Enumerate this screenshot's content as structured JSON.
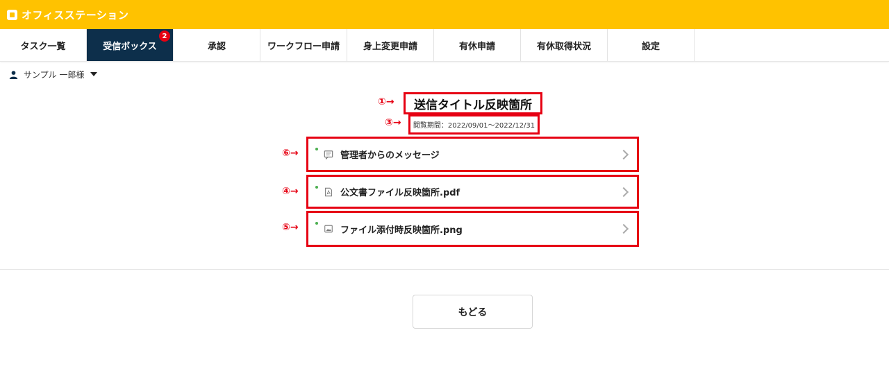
{
  "app": {
    "name": "オフィスステーション"
  },
  "nav": {
    "tabs": [
      {
        "label": "タスク一覧"
      },
      {
        "label": "受信ボックス",
        "badge": "2",
        "active": true
      },
      {
        "label": "承認"
      },
      {
        "label": "ワークフロー申請"
      },
      {
        "label": "身上変更申請"
      },
      {
        "label": "有休申請"
      },
      {
        "label": "有休取得状況"
      },
      {
        "label": "設定"
      }
    ]
  },
  "user": {
    "name": "サンプル 一郎様"
  },
  "annotations": {
    "title_marker": "①→",
    "period_marker": "③→",
    "message_marker": "⑥→",
    "pdf_marker": "④→",
    "png_marker": "⑤→"
  },
  "content": {
    "title": "送信タイトル反映箇所",
    "period": "閲覧期間：2022/09/01～2022/12/31",
    "items": [
      {
        "label": "管理者からのメッセージ",
        "icon": "message-icon"
      },
      {
        "label": "公文書ファイル反映箇所.pdf",
        "icon": "pdf-file-icon"
      },
      {
        "label": "ファイル添付時反映箇所.png",
        "icon": "image-file-icon"
      }
    ]
  },
  "back_button": {
    "label": "もどる"
  },
  "colors": {
    "header": "#ffc200",
    "active_tab": "#0d2f4b",
    "badge": "#e60012",
    "annotation": "#e60012"
  }
}
